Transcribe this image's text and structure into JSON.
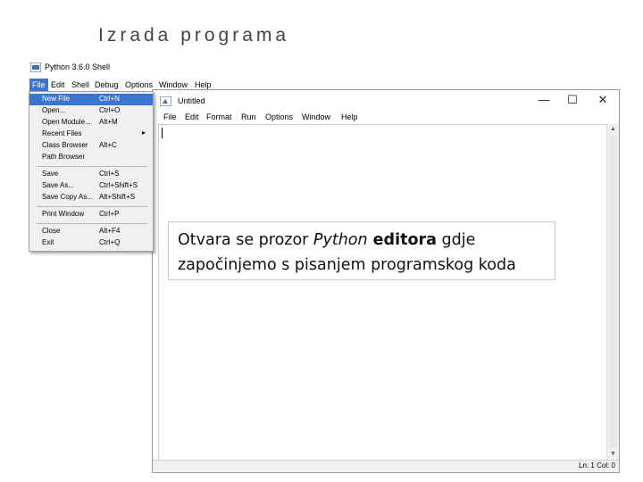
{
  "slide": {
    "title": "Izrada programa"
  },
  "shell": {
    "title": "Python 3.6.0 Shell",
    "menu": [
      "File",
      "Edit",
      "Shell",
      "Debug",
      "Options",
      "Window",
      "Help"
    ]
  },
  "dropdown": {
    "items": [
      {
        "label": "New File",
        "shortcut": "Ctrl+N"
      },
      {
        "label": "Open...",
        "shortcut": "Ctrl+O"
      },
      {
        "label": "Open Module...",
        "shortcut": "Alt+M"
      },
      {
        "label": "Recent Files",
        "shortcut": ""
      },
      {
        "label": "Class Browser",
        "shortcut": "Alt+C"
      },
      {
        "label": "Path Browser",
        "shortcut": ""
      },
      {
        "label": "Save",
        "shortcut": "Ctrl+S"
      },
      {
        "label": "Save As...",
        "shortcut": "Ctrl+Shift+S"
      },
      {
        "label": "Save Copy As...",
        "shortcut": "Alt+Shift+S"
      },
      {
        "label": "Print Window",
        "shortcut": "Ctrl+P"
      },
      {
        "label": "Close",
        "shortcut": "Alt+F4"
      },
      {
        "label": "Exit",
        "shortcut": "Ctrl+Q"
      }
    ]
  },
  "editor": {
    "title": "Untitled",
    "menu": [
      "File",
      "Edit",
      "Format",
      "Run",
      "Options",
      "Window",
      "Help"
    ],
    "status": "Ln: 1  Col: 0",
    "controls": {
      "minimize": "—",
      "maximize": "☐",
      "close": "✕"
    }
  },
  "callout": {
    "part1": "Otvara se prozor ",
    "italic": "Python",
    "bold": " editora",
    "part2": " gdje",
    "line2": "započinjemo s pisanjem programskog koda"
  },
  "colors": {
    "menu_highlight": "#3a76d0"
  }
}
